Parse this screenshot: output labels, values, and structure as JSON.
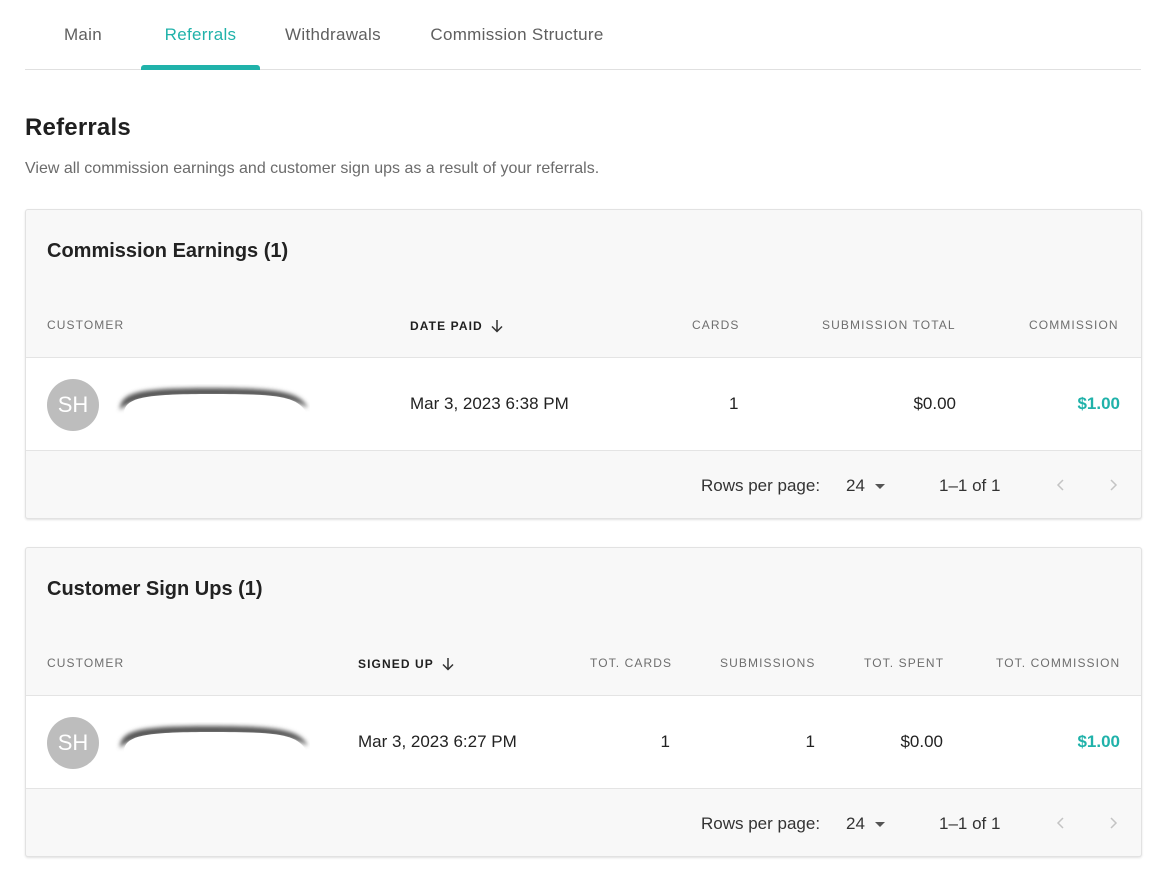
{
  "tabs": [
    {
      "label": "Main"
    },
    {
      "label": "Referrals"
    },
    {
      "label": "Withdrawals"
    },
    {
      "label": "Commission Structure"
    }
  ],
  "active_tab": "Referrals",
  "page": {
    "title": "Referrals",
    "description": "View all commission earnings and customer sign ups as a result of your referrals."
  },
  "commission_earnings": {
    "title": "Commission Earnings (1)",
    "headers": {
      "customer": "CUSTOMER",
      "date_paid": "DATE PAID",
      "cards": "CARDS",
      "submission_total": "SUBMISSION TOTAL",
      "commission": "COMMISSION"
    },
    "sorted_column": "date_paid",
    "rows": [
      {
        "avatar_initials": "SH",
        "customer_name_redacted": true,
        "date_paid": "Mar 3, 2023 6:38 PM",
        "cards": "1",
        "submission_total": "$0.00",
        "commission": "$1.00"
      }
    ],
    "pagination": {
      "rows_per_page_label": "Rows per page:",
      "rows_per_page": "24",
      "range": "1–1 of 1"
    }
  },
  "customer_signups": {
    "title": "Customer Sign Ups (1)",
    "headers": {
      "customer": "CUSTOMER",
      "signed_up": "SIGNED UP",
      "tot_cards": "TOT. CARDS",
      "submissions": "SUBMISSIONS",
      "tot_spent": "TOT. SPENT",
      "tot_commission": "TOT. COMMISSION"
    },
    "sorted_column": "signed_up",
    "rows": [
      {
        "avatar_initials": "SH",
        "customer_name_redacted": true,
        "signed_up": "Mar 3, 2023 6:27 PM",
        "tot_cards": "1",
        "submissions": "1",
        "tot_spent": "$0.00",
        "tot_commission": "$1.00"
      }
    ],
    "pagination": {
      "rows_per_page_label": "Rows per page:",
      "rows_per_page": "24",
      "range": "1–1 of 1"
    }
  },
  "colors": {
    "accent": "#20b2aa",
    "avatar": "#bdbdbd"
  },
  "icons": {
    "sort": "arrow-down-icon",
    "prev": "chevron-left-icon",
    "next": "chevron-right-icon",
    "dropdown": "caret-down-icon"
  }
}
